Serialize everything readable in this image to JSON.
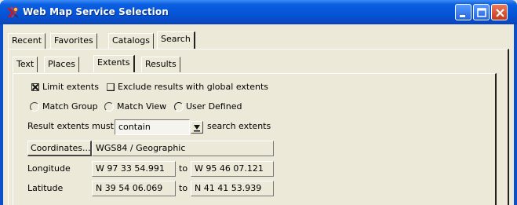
{
  "window": {
    "title": "Web Map Service Selection",
    "icon": "wms-app-icon",
    "controls": [
      "minimize-icon",
      "maximize-icon",
      "close-icon"
    ]
  },
  "top_tabs": [
    {
      "label": "Recent",
      "active": false
    },
    {
      "label": "Favorites",
      "active": false
    },
    {
      "label": "Catalogs",
      "active": false
    },
    {
      "label": "Search",
      "active": true
    }
  ],
  "sub_tabs": [
    {
      "label": "Text",
      "active": false
    },
    {
      "label": "Places",
      "active": false
    },
    {
      "label": "Extents",
      "active": true
    },
    {
      "label": "Results",
      "active": false
    }
  ],
  "options": {
    "limit_extents": {
      "label": "Limit extents",
      "checked": true
    },
    "exclude_global": {
      "label": "Exclude results with global extents",
      "checked": false
    }
  },
  "radios": [
    {
      "label": "Match Group",
      "selected": false
    },
    {
      "label": "Match View",
      "selected": false
    },
    {
      "label": "User Defined",
      "selected": true
    }
  ],
  "result_extents": {
    "prefix": "Result extents must",
    "value": "contain",
    "suffix": "search extents"
  },
  "coordinates": {
    "button_label": "Coordinates...",
    "system": "WGS84 / Geographic"
  },
  "longitude": {
    "label": "Longitude",
    "from": "W 97 33 54.991",
    "to_label": "to",
    "to": "W 95 46 07.121"
  },
  "latitude": {
    "label": "Latitude",
    "from": "N 39 54 06.069",
    "to_label": "to",
    "to": "N 41 41 53.939"
  },
  "colors": {
    "titlebar": "#0553d6",
    "face": "#ece9d8",
    "close": "#c5391a"
  }
}
